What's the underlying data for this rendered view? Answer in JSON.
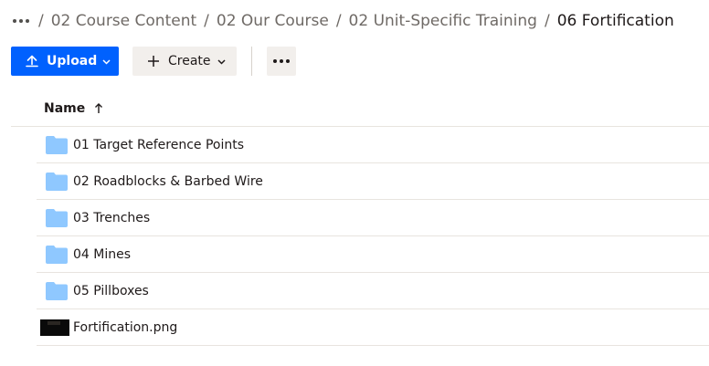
{
  "breadcrumb": {
    "items": [
      "02 Course Content",
      "02 Our Course",
      "02 Unit-Specific Training"
    ],
    "current": "06 Fortification",
    "separator": "/"
  },
  "toolbar": {
    "upload_label": "Upload",
    "create_label": "Create"
  },
  "list": {
    "name_header": "Name",
    "rows": [
      {
        "type": "folder",
        "name": "01 Target Reference Points"
      },
      {
        "type": "folder",
        "name": "02 Roadblocks & Barbed Wire"
      },
      {
        "type": "folder",
        "name": "03 Trenches"
      },
      {
        "type": "folder",
        "name": "04 Mines"
      },
      {
        "type": "folder",
        "name": "05 Pillboxes"
      },
      {
        "type": "image",
        "name": "Fortification.png"
      }
    ]
  },
  "colors": {
    "primary": "#0061fe",
    "folder": "#8fc8ff",
    "secondary_button": "#f2efec"
  }
}
